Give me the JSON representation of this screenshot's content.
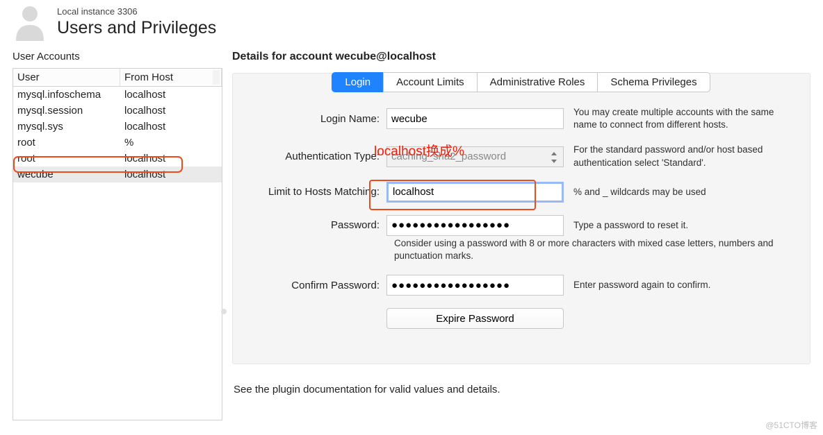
{
  "header": {
    "instance_label": "Local instance 3306",
    "page_title": "Users and Privileges"
  },
  "left": {
    "section": "User Accounts",
    "columns": {
      "user": "User",
      "host": "From Host"
    },
    "rows": [
      {
        "user": "mysql.infoschema",
        "host": "localhost",
        "selected": false
      },
      {
        "user": "mysql.session",
        "host": "localhost",
        "selected": false
      },
      {
        "user": "mysql.sys",
        "host": "localhost",
        "selected": false
      },
      {
        "user": "root",
        "host": "%",
        "selected": false
      },
      {
        "user": "root",
        "host": "localhost",
        "selected": false
      },
      {
        "user": "wecube",
        "host": "localhost",
        "selected": true
      }
    ]
  },
  "details": {
    "heading": "Details for account wecube@localhost",
    "tabs": [
      {
        "id": "login",
        "label": "Login",
        "active": true
      },
      {
        "id": "limits",
        "label": "Account Limits",
        "active": false
      },
      {
        "id": "admin",
        "label": "Administrative Roles",
        "active": false
      },
      {
        "id": "schema",
        "label": "Schema Privileges",
        "active": false
      }
    ],
    "form": {
      "login_name": {
        "label": "Login Name:",
        "value": "wecube",
        "hint": "You may create multiple accounts with the same name to connect from different hosts."
      },
      "auth_type": {
        "label": "Authentication Type:",
        "value": "caching_sha2_password",
        "hint": "For the standard password and/or host based authentication select 'Standard'."
      },
      "limit_hosts": {
        "label": "Limit to Hosts Matching:",
        "value": "localhost",
        "hint": "% and _ wildcards may be used"
      },
      "password": {
        "label": "Password:",
        "value": "●●●●●●●●●●●●●●●●●",
        "hint": "Type a password to reset it."
      },
      "password_advice": "Consider using a password with 8 or more characters with mixed case letters, numbers and punctuation marks.",
      "confirm_password": {
        "label": "Confirm Password:",
        "value": "●●●●●●●●●●●●●●●●●",
        "hint": "Enter password again to confirm."
      },
      "expire_button": "Expire Password"
    },
    "plugin_note": "See the plugin documentation for valid values and details."
  },
  "annotations": {
    "host_hint_zh": "localhost换成%"
  },
  "watermark": "@51CTO博客"
}
